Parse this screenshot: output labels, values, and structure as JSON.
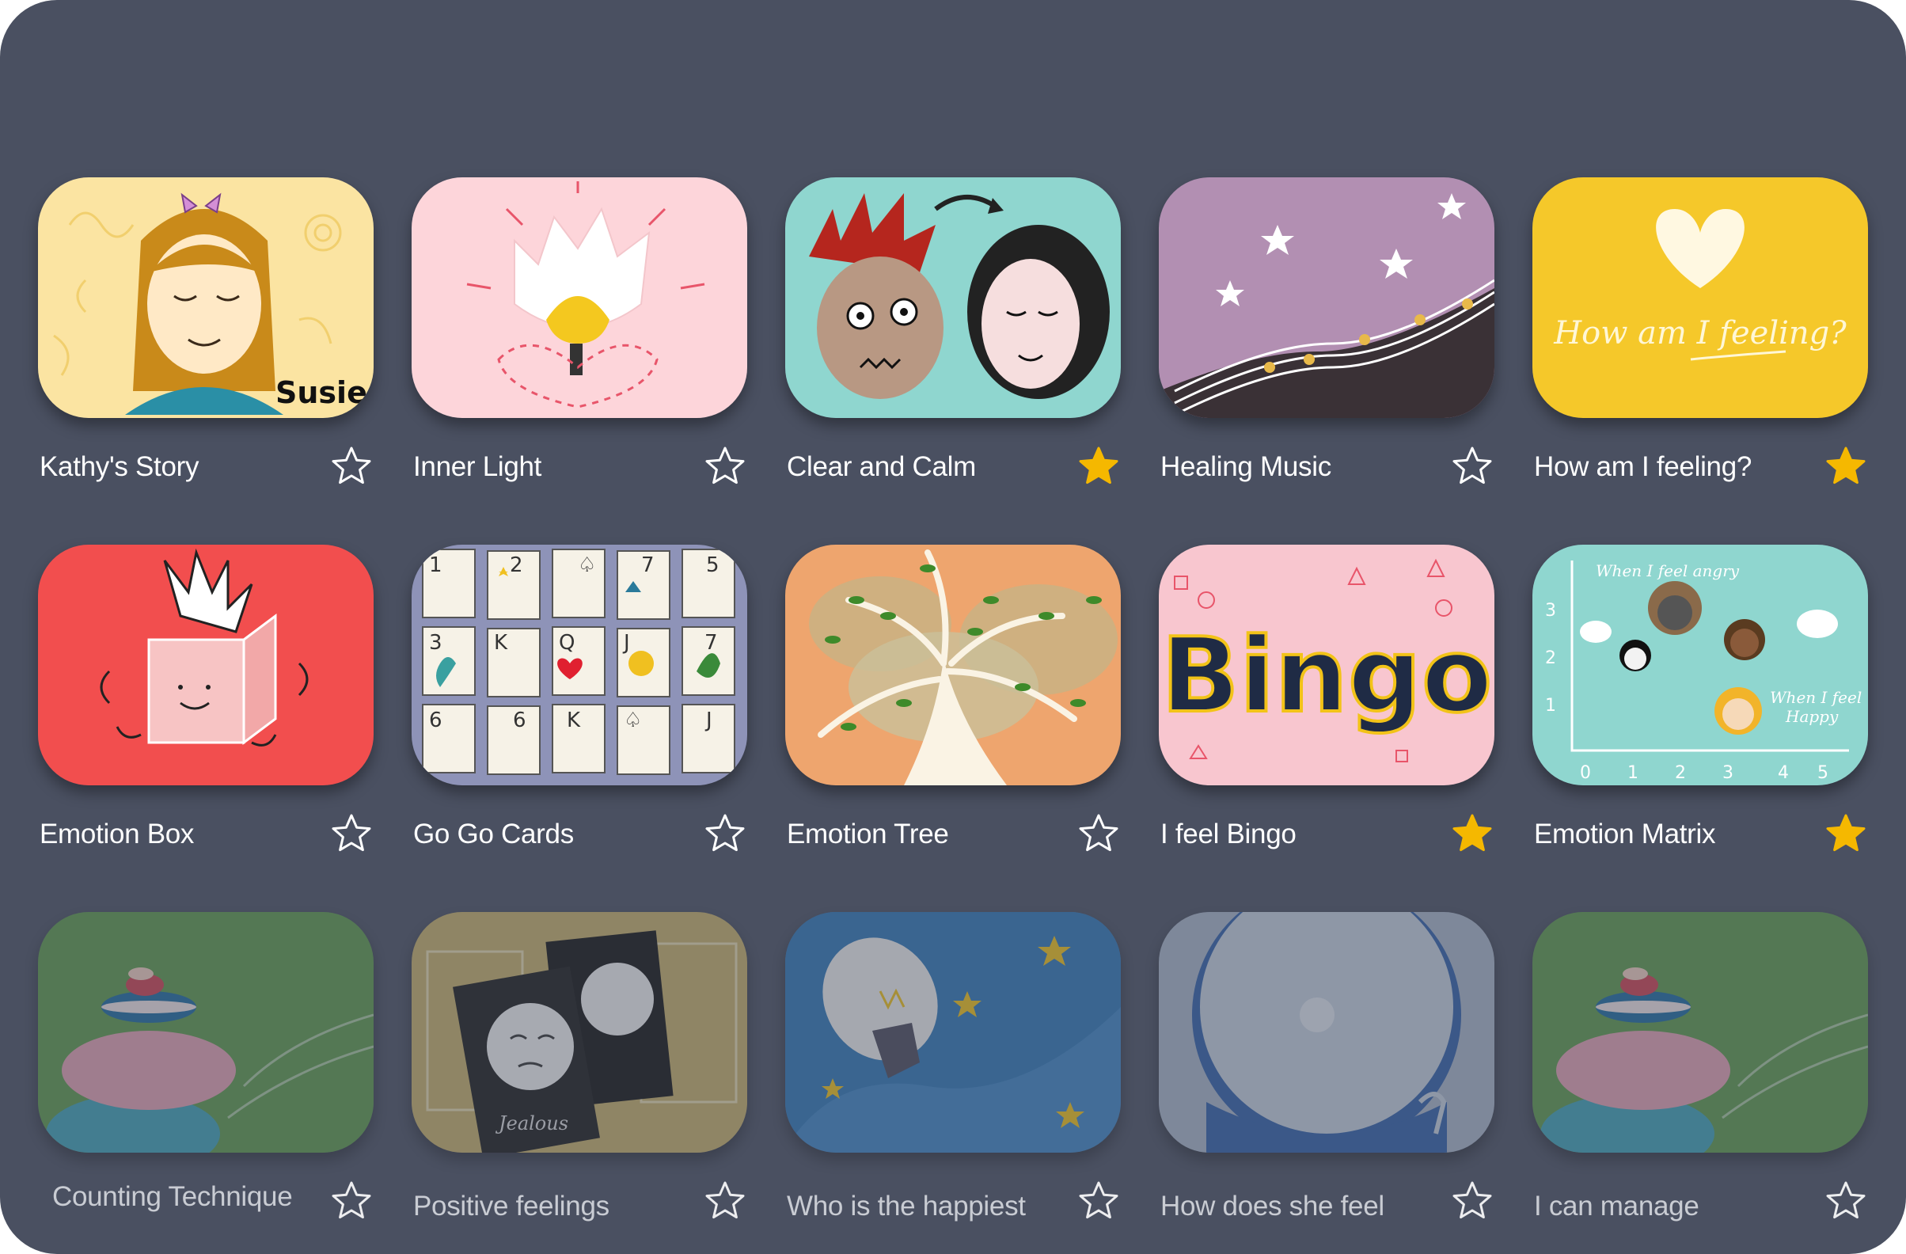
{
  "colors": {
    "background": "#4a5061",
    "favorite_star": "#f5b800",
    "star_outline": "#ffffff"
  },
  "activities": [
    {
      "title": "Kathy's Story",
      "favorite": false,
      "available": true,
      "image_label": "Susie",
      "icon": "girl-portrait-illustration"
    },
    {
      "title": "Inner Light",
      "favorite": false,
      "available": true,
      "icon": "glowing-flower-illustration"
    },
    {
      "title": "Clear and Calm",
      "favorite": true,
      "available": true,
      "icon": "angry-to-calm-faces-illustration"
    },
    {
      "title": "Healing Music",
      "favorite": false,
      "available": true,
      "icon": "moon-stars-music-illustration"
    },
    {
      "title": "How am I feeling?",
      "favorite": true,
      "available": true,
      "image_label": "How am I feeling?",
      "icon": "heart-illustration"
    },
    {
      "title": "Emotion Box",
      "favorite": false,
      "available": true,
      "icon": "emotion-box-illustration"
    },
    {
      "title": "Go Go Cards",
      "favorite": false,
      "available": true,
      "icon": "card-grid-illustration"
    },
    {
      "title": "Emotion Tree",
      "favorite": false,
      "available": true,
      "icon": "tree-illustration"
    },
    {
      "title": "I feel Bingo",
      "favorite": true,
      "available": true,
      "image_label": "Bingo",
      "icon": "bingo-illustration"
    },
    {
      "title": "Emotion Matrix",
      "favorite": true,
      "available": true,
      "image_label": "When I feel angry / When I feel Happy",
      "icon": "emotion-matrix-chart-illustration"
    },
    {
      "title": "Counting Technique",
      "favorite": false,
      "available": false,
      "icon": "stacked-stones-illustration"
    },
    {
      "title": "Positive feelings",
      "favorite": false,
      "available": false,
      "image_label": "Jealous",
      "icon": "emotion-cards-illustration"
    },
    {
      "title": "Who is the happiest",
      "favorite": false,
      "available": false,
      "icon": "lightbulb-illustration"
    },
    {
      "title": "How does she feel",
      "favorite": false,
      "available": false,
      "icon": "mirror-illustration"
    },
    {
      "title": "I can manage",
      "favorite": false,
      "available": false,
      "icon": "stacked-stones-illustration"
    }
  ]
}
